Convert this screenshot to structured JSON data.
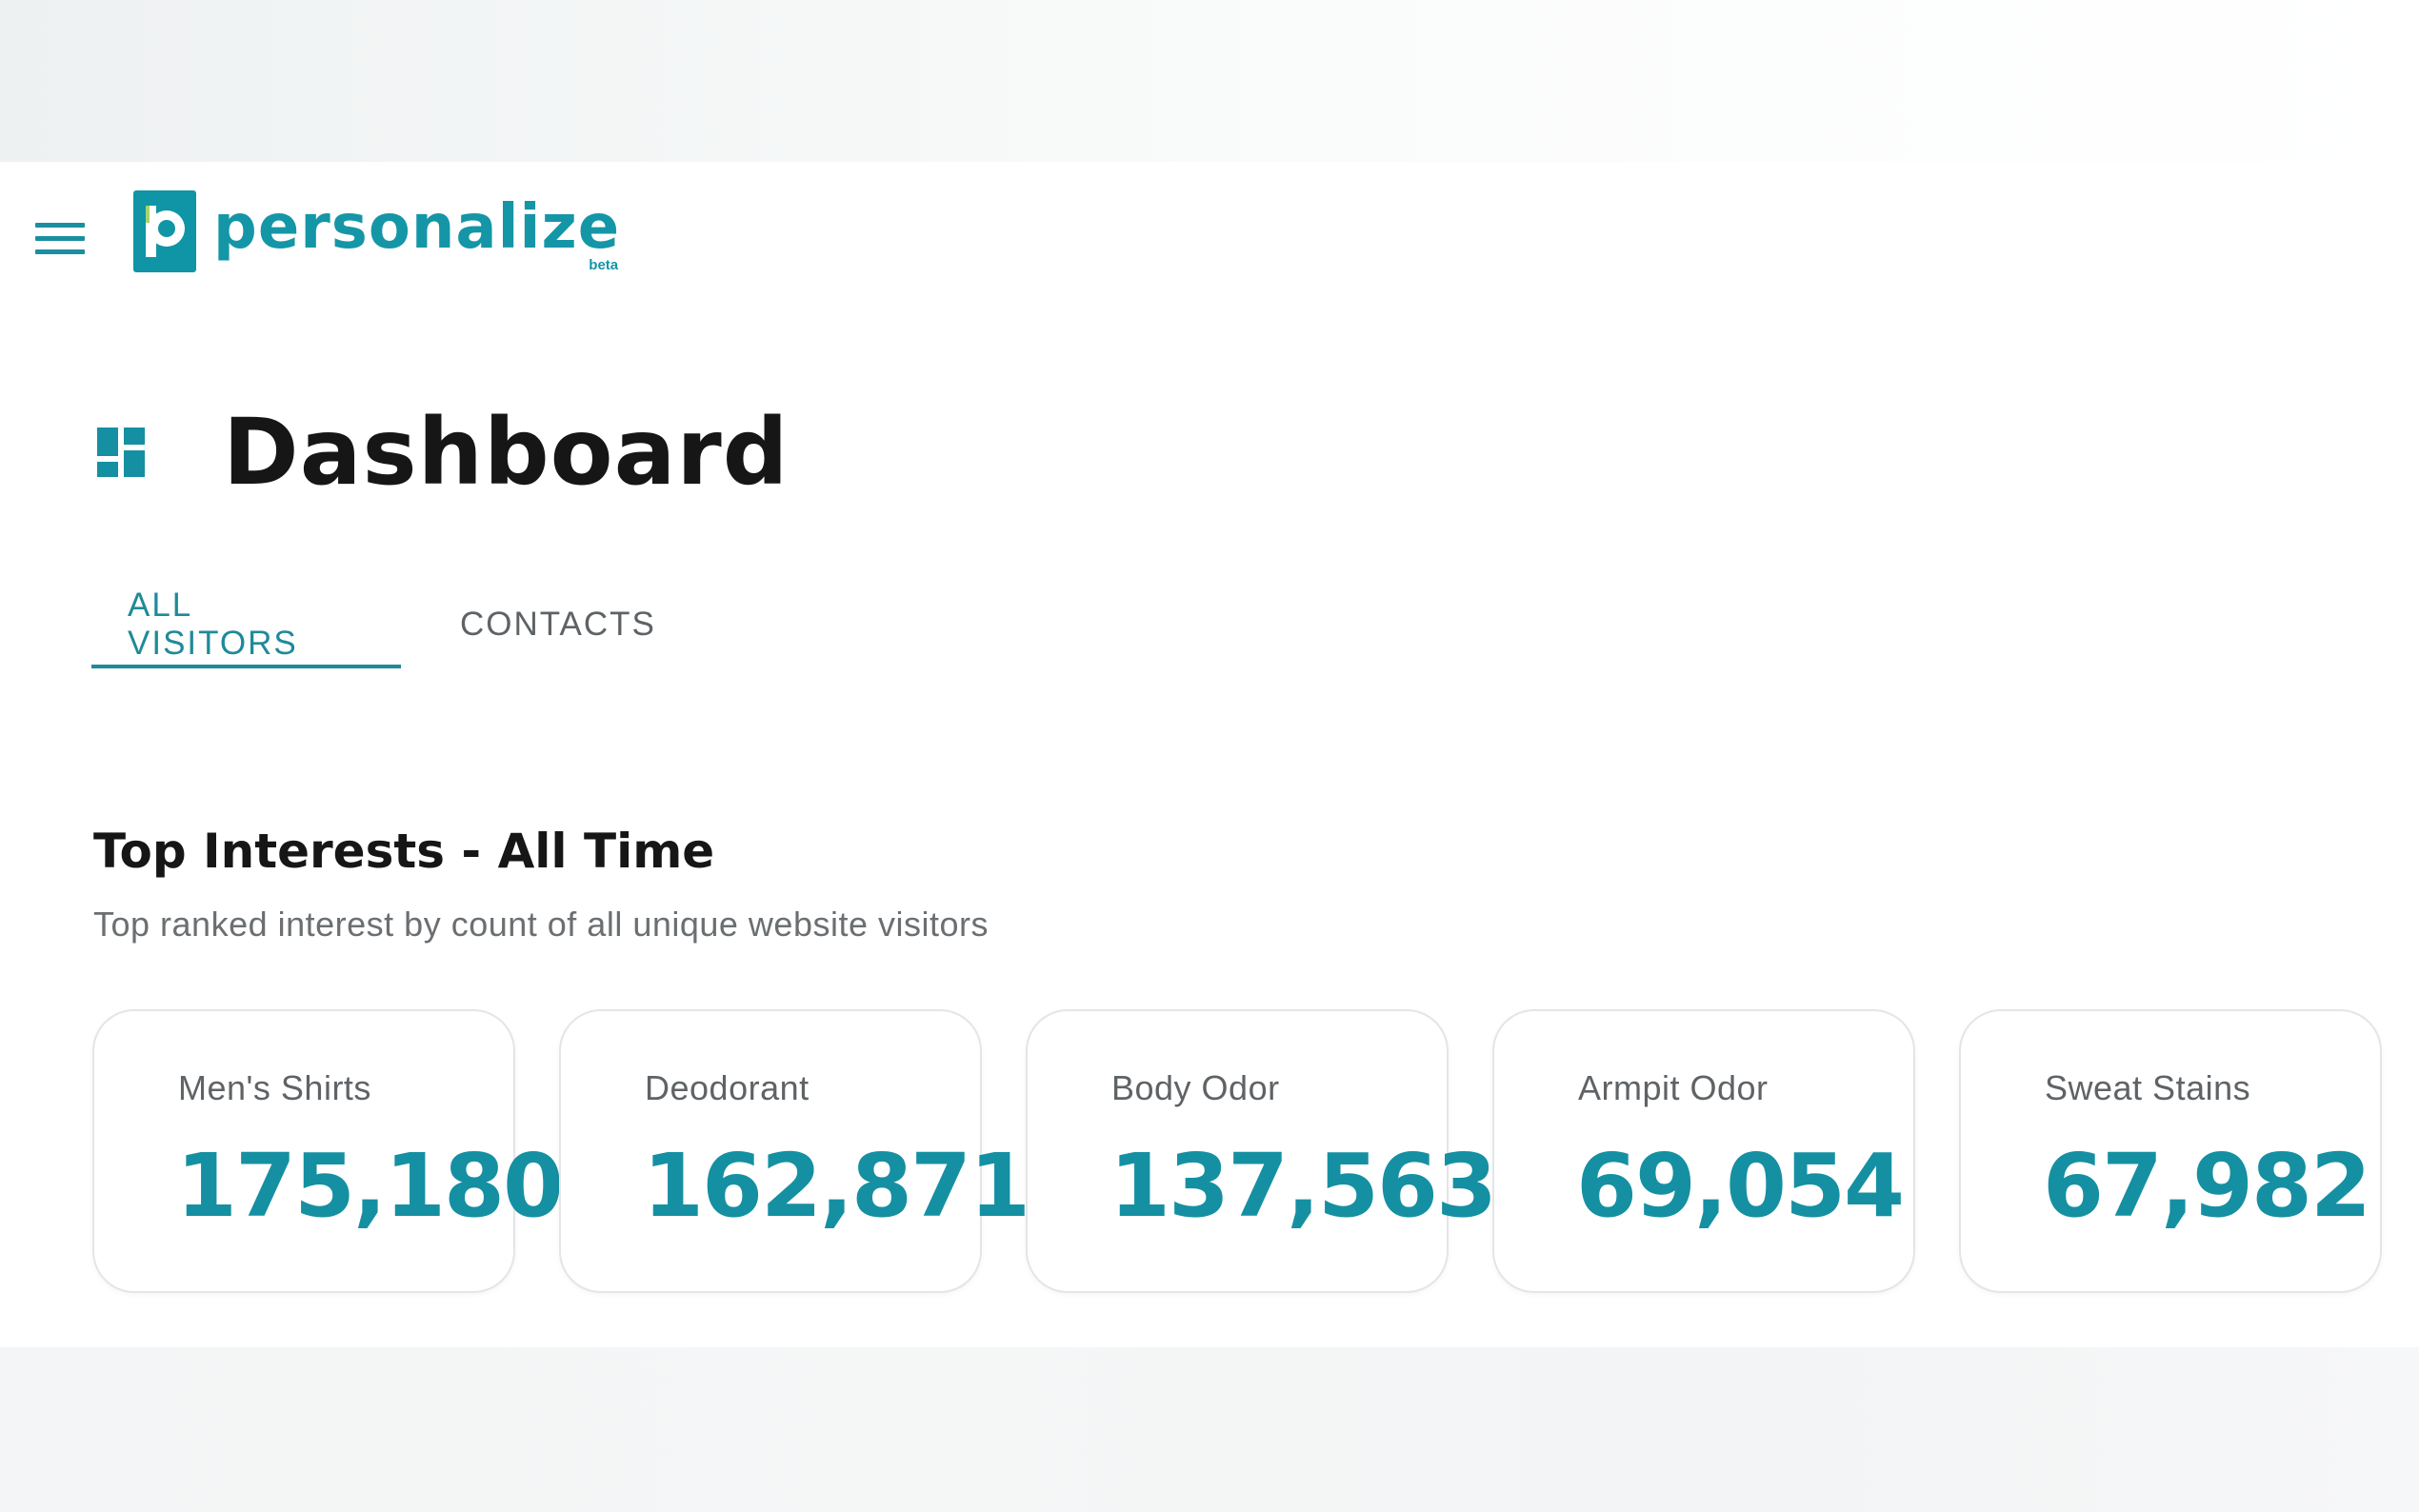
{
  "header": {
    "menu_icon": "hamburger-menu-icon",
    "logo": {
      "icon": "p-logo-icon",
      "name": "personalize",
      "badge": "beta"
    }
  },
  "page": {
    "icon": "dashboard-icon",
    "title": "Dashboard"
  },
  "tabs": [
    {
      "label": "ALL VISITORS",
      "active": true
    },
    {
      "label": "CONTACTS",
      "active": false
    }
  ],
  "section": {
    "title": "Top Interests - All Time",
    "subtitle": "Top ranked interest by count of all unique website visitors"
  },
  "interests": [
    {
      "label": "Men's Shirts",
      "value": "175,180"
    },
    {
      "label": "Deodorant",
      "value": "162,871"
    },
    {
      "label": "Body Odor",
      "value": "137,563"
    },
    {
      "label": "Armpit Odor",
      "value": "69,054"
    },
    {
      "label": "Sweat Stains",
      "value": "67,982"
    }
  ],
  "colors": {
    "accent": "#1590a2",
    "text_dark": "#161616",
    "text_muted": "#6b6f72",
    "card_border": "#e3e5e6"
  }
}
